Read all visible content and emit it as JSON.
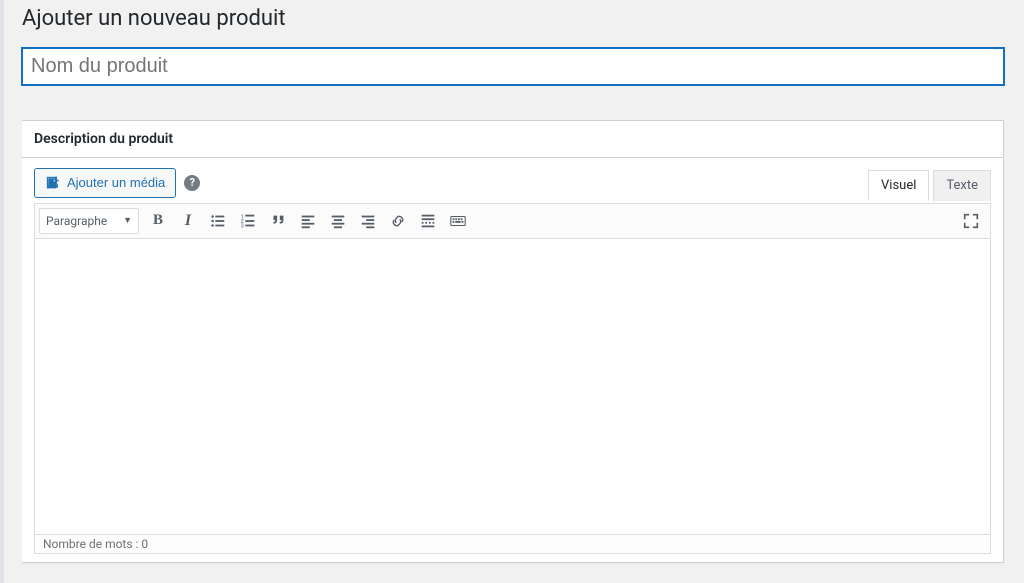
{
  "page": {
    "title": "Ajouter un nouveau produit"
  },
  "product_title": {
    "value": "",
    "placeholder": "Nom du produit"
  },
  "description_box": {
    "heading": "Description du produit",
    "add_media_label": "Ajouter un média",
    "tabs": {
      "visual": "Visuel",
      "text": "Texte"
    },
    "format_select": "Paragraphe",
    "status": "Nombre de mots : 0"
  },
  "icons": {
    "help": "?"
  }
}
